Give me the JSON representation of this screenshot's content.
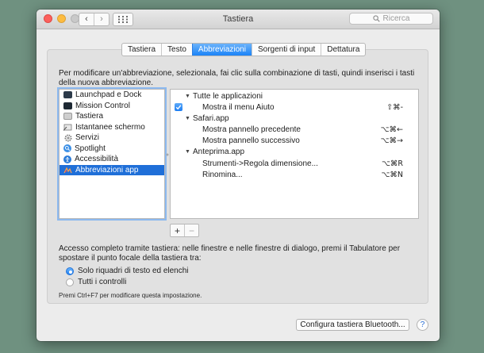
{
  "window": {
    "title": "Tastiera"
  },
  "toolbar": {
    "back": "‹",
    "forward": "›",
    "search_placeholder": "Ricerca"
  },
  "tabs": [
    {
      "label": "Tastiera",
      "selected": false
    },
    {
      "label": "Testo",
      "selected": false
    },
    {
      "label": "Abbreviazioni",
      "selected": true
    },
    {
      "label": "Sorgenti di input",
      "selected": false
    },
    {
      "label": "Dettatura",
      "selected": false
    }
  ],
  "instructions": "Per modificare un'abbreviazione, selezionala, fai clic sulla combinazione di tasti, quindi inserisci i tasti della nuova abbreviazione.",
  "categories": [
    {
      "label": "Launchpad e Dock",
      "icon": "launchpad-icon"
    },
    {
      "label": "Mission Control",
      "icon": "mission-control-icon"
    },
    {
      "label": "Tastiera",
      "icon": "keyboard-icon"
    },
    {
      "label": "Istantanee schermo",
      "icon": "screenshot-icon"
    },
    {
      "label": "Servizi",
      "icon": "gear-icon"
    },
    {
      "label": "Spotlight",
      "icon": "spotlight-icon"
    },
    {
      "label": "Accessibilità",
      "icon": "accessibility-icon"
    },
    {
      "label": "Abbreviazioni app",
      "icon": "app-shortcuts-icon",
      "selected": true
    }
  ],
  "shortcuts": {
    "group_all": "Tutte le applicazioni",
    "item_help": {
      "name": "Mostra il menu Aiuto",
      "keys": "⇧⌘-",
      "checked": true
    },
    "group_safari": "Safari.app",
    "item_prev": {
      "name": "Mostra pannello precedente",
      "keys": "⌥⌘←"
    },
    "item_next": {
      "name": "Mostra pannello successivo",
      "keys": "⌥⌘→"
    },
    "group_preview": "Anteprima.app",
    "item_resize": {
      "name": "Strumenti->Regola dimensione...",
      "keys": "⌥⌘R"
    },
    "item_rename": {
      "name": "Rinomina...",
      "keys": "⌥⌘N"
    }
  },
  "buttons": {
    "add": "+",
    "remove": "−"
  },
  "keyboard_access": {
    "description": "Accesso completo tramite tastiera: nelle finestre e nelle finestre di dialogo, premi il Tabulatore per spostare il punto focale della tastiera tra:",
    "option_text_boxes": "Solo riquadri di testo ed elenchi",
    "option_all_controls": "Tutti i controlli",
    "selected_option": "Solo riquadri di testo ed elenchi",
    "note": "Premi Ctrl+F7 per modificare questa impostazione."
  },
  "footer": {
    "bluetooth_button": "Configura tastiera Bluetooth...",
    "help_button": "?"
  }
}
